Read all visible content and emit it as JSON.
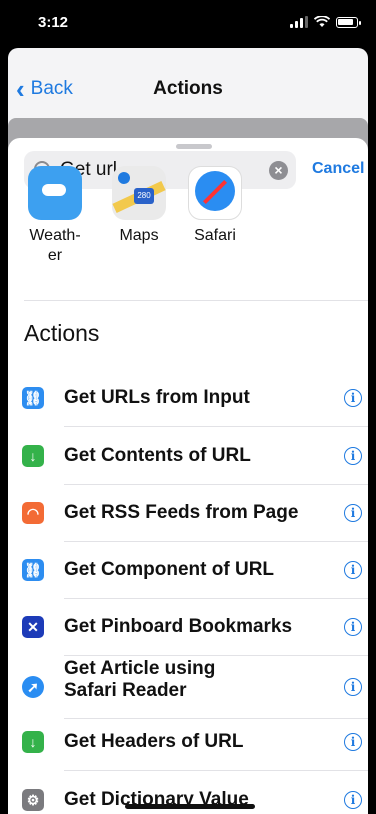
{
  "status": {
    "time": "3:12"
  },
  "nav": {
    "back_label": "Back",
    "title": "Actions"
  },
  "search": {
    "value": "Get url",
    "cancel_label": "Cancel"
  },
  "apps": [
    {
      "label": "Weath-\ner",
      "icon": "weather-icon"
    },
    {
      "label": "Maps",
      "icon": "maps-icon"
    },
    {
      "label": "Safari",
      "icon": "safari-icon"
    }
  ],
  "section_title": "Actions",
  "actions": [
    {
      "label": "Get URLs from Input",
      "icon": "link-icon",
      "color": "#2d8df0"
    },
    {
      "label": "Get Contents of URL",
      "icon": "download-arrow-icon",
      "color": "#34b24a"
    },
    {
      "label": "Get RSS Feeds from Page",
      "icon": "rss-icon",
      "color": "#f36b35"
    },
    {
      "label": "Get Component of URL",
      "icon": "link-icon",
      "color": "#2d8df0"
    },
    {
      "label": "Get Pinboard Bookmarks",
      "icon": "pin-icon",
      "color": "#1d3bb8"
    },
    {
      "label": "Get Article using\nSafari Reader",
      "icon": "safari-icon",
      "color": "#2a8df2"
    },
    {
      "label": "Get Headers of URL",
      "icon": "download-arrow-icon",
      "color": "#34b24a"
    },
    {
      "label": "Get Dictionary Value",
      "icon": "gear-icon",
      "color": "#7a7a7e"
    }
  ],
  "colors": {
    "accent": "#1f7ae0"
  }
}
